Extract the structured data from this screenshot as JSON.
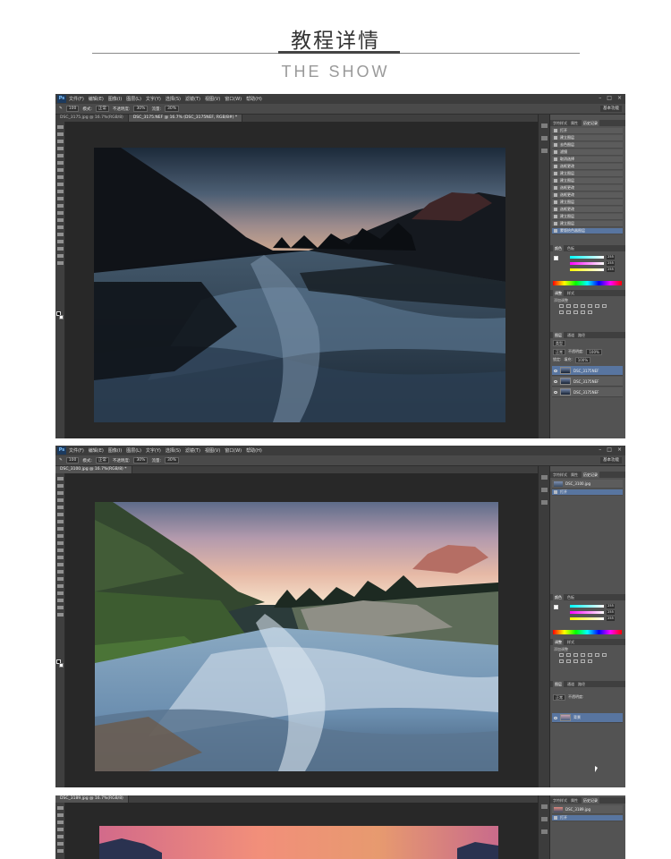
{
  "header": {
    "title_cn": "教程详情",
    "title_en": "THE SHOW"
  },
  "app": {
    "logo": "Ps",
    "menu": [
      "文件(F)",
      "编辑(E)",
      "图像(I)",
      "图层(L)",
      "文字(Y)",
      "选择(S)",
      "滤镜(T)",
      "视图(V)",
      "窗口(W)",
      "帮助(H)"
    ],
    "window_controls": [
      "–",
      "□",
      "×"
    ]
  },
  "window1": {
    "options": {
      "brush_size": "100",
      "mode_label": "模式:",
      "mode_value": "正常",
      "opacity_label": "不透明度:",
      "opacity_value": "30%",
      "flow_label": "流量:",
      "flow_value": "30%",
      "workspace": "基本功能"
    },
    "doc_tabs": [
      "DSC_3175.jpg @ 16.7%(RGB/8)",
      "DSC_3175.NEF @ 16.7% (DSC_3175NEF, RGB/8#) *"
    ],
    "history_tabs": [
      "字符样式",
      "属性",
      "历史记录"
    ],
    "history_items": [
      "打开",
      "建立图层",
      "去色图层",
      "滤镜",
      "取消选择",
      "选框更改",
      "建立图层",
      "建立图层",
      "选框更改",
      "选框更改",
      "建立图层",
      "选框更改",
      "建立图层",
      "建立图层",
      "蒙版拾色器图层"
    ],
    "color_tabs": [
      "颜色",
      "色板"
    ],
    "color_values": [
      "255",
      "255",
      "255"
    ],
    "adj_tabs": [
      "调整",
      "样式"
    ],
    "adj_label": "添加调整",
    "layers_tabs": [
      "图层",
      "通道",
      "路径"
    ],
    "layers_kind": "类型",
    "layers_mode": "正常",
    "layers_opacity_label": "不透明度:",
    "layers_opacity_value": "100%",
    "layers_lock_label": "锁定:",
    "layers_fill_label": "填充:",
    "layers_fill_value": "100%",
    "layers": [
      "DSC_3175NEF",
      "DSC_3175NEF",
      "DSC_3175NEF"
    ]
  },
  "window2": {
    "options": {
      "brush_size": "100",
      "mode_label": "模式:",
      "mode_value": "正常",
      "opacity_label": "不透明度:",
      "opacity_value": "30%",
      "flow_label": "流量:",
      "flow_value": "30%",
      "workspace": "基本功能"
    },
    "doc_tabs": [
      "DSC_3100.jpg @ 16.7%(RGB/8) *"
    ],
    "history_tabs": [
      "字符样式",
      "属性",
      "历史记录"
    ],
    "history_items": [
      "DSC_3100.jpg",
      "打开"
    ],
    "color_tabs": [
      "颜色",
      "色板"
    ],
    "color_values": [
      "255",
      "255",
      "255"
    ],
    "adj_tabs": [
      "调整",
      "样式"
    ],
    "adj_label": "添加调整",
    "layers_tabs": [
      "图层",
      "通道",
      "路径"
    ],
    "layers_mode": "正常",
    "layers_opacity_label": "不透明度:",
    "layers": [
      "背景"
    ]
  },
  "window3": {
    "doc_tabs": [
      "DSC_3189.jpg @ 16.7%(RGB/8)"
    ],
    "history_tabs": [
      "字符样式",
      "属性",
      "历史记录"
    ],
    "history_items": [
      "DSC_3189.jpg",
      "打开"
    ]
  }
}
